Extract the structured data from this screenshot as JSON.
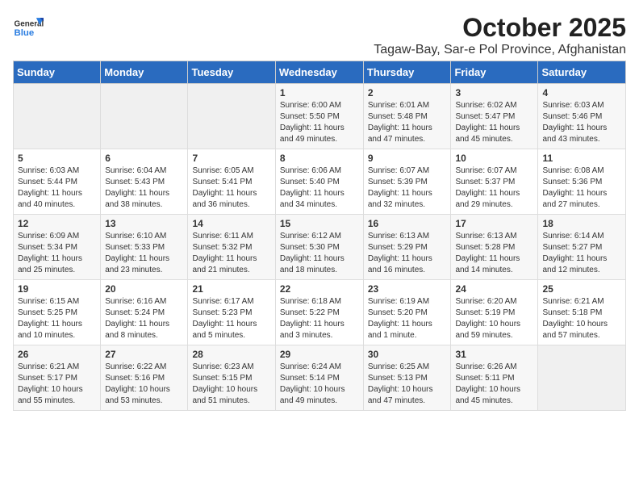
{
  "header": {
    "logo_general": "General",
    "logo_blue": "Blue",
    "title": "October 2025",
    "subtitle": "Tagaw-Bay, Sar-e Pol Province, Afghanistan"
  },
  "calendar": {
    "days_of_week": [
      "Sunday",
      "Monday",
      "Tuesday",
      "Wednesday",
      "Thursday",
      "Friday",
      "Saturday"
    ],
    "weeks": [
      [
        {
          "num": "",
          "info": ""
        },
        {
          "num": "",
          "info": ""
        },
        {
          "num": "",
          "info": ""
        },
        {
          "num": "1",
          "info": "Sunrise: 6:00 AM\nSunset: 5:50 PM\nDaylight: 11 hours and 49 minutes."
        },
        {
          "num": "2",
          "info": "Sunrise: 6:01 AM\nSunset: 5:48 PM\nDaylight: 11 hours and 47 minutes."
        },
        {
          "num": "3",
          "info": "Sunrise: 6:02 AM\nSunset: 5:47 PM\nDaylight: 11 hours and 45 minutes."
        },
        {
          "num": "4",
          "info": "Sunrise: 6:03 AM\nSunset: 5:46 PM\nDaylight: 11 hours and 43 minutes."
        }
      ],
      [
        {
          "num": "5",
          "info": "Sunrise: 6:03 AM\nSunset: 5:44 PM\nDaylight: 11 hours and 40 minutes."
        },
        {
          "num": "6",
          "info": "Sunrise: 6:04 AM\nSunset: 5:43 PM\nDaylight: 11 hours and 38 minutes."
        },
        {
          "num": "7",
          "info": "Sunrise: 6:05 AM\nSunset: 5:41 PM\nDaylight: 11 hours and 36 minutes."
        },
        {
          "num": "8",
          "info": "Sunrise: 6:06 AM\nSunset: 5:40 PM\nDaylight: 11 hours and 34 minutes."
        },
        {
          "num": "9",
          "info": "Sunrise: 6:07 AM\nSunset: 5:39 PM\nDaylight: 11 hours and 32 minutes."
        },
        {
          "num": "10",
          "info": "Sunrise: 6:07 AM\nSunset: 5:37 PM\nDaylight: 11 hours and 29 minutes."
        },
        {
          "num": "11",
          "info": "Sunrise: 6:08 AM\nSunset: 5:36 PM\nDaylight: 11 hours and 27 minutes."
        }
      ],
      [
        {
          "num": "12",
          "info": "Sunrise: 6:09 AM\nSunset: 5:34 PM\nDaylight: 11 hours and 25 minutes."
        },
        {
          "num": "13",
          "info": "Sunrise: 6:10 AM\nSunset: 5:33 PM\nDaylight: 11 hours and 23 minutes."
        },
        {
          "num": "14",
          "info": "Sunrise: 6:11 AM\nSunset: 5:32 PM\nDaylight: 11 hours and 21 minutes."
        },
        {
          "num": "15",
          "info": "Sunrise: 6:12 AM\nSunset: 5:30 PM\nDaylight: 11 hours and 18 minutes."
        },
        {
          "num": "16",
          "info": "Sunrise: 6:13 AM\nSunset: 5:29 PM\nDaylight: 11 hours and 16 minutes."
        },
        {
          "num": "17",
          "info": "Sunrise: 6:13 AM\nSunset: 5:28 PM\nDaylight: 11 hours and 14 minutes."
        },
        {
          "num": "18",
          "info": "Sunrise: 6:14 AM\nSunset: 5:27 PM\nDaylight: 11 hours and 12 minutes."
        }
      ],
      [
        {
          "num": "19",
          "info": "Sunrise: 6:15 AM\nSunset: 5:25 PM\nDaylight: 11 hours and 10 minutes."
        },
        {
          "num": "20",
          "info": "Sunrise: 6:16 AM\nSunset: 5:24 PM\nDaylight: 11 hours and 8 minutes."
        },
        {
          "num": "21",
          "info": "Sunrise: 6:17 AM\nSunset: 5:23 PM\nDaylight: 11 hours and 5 minutes."
        },
        {
          "num": "22",
          "info": "Sunrise: 6:18 AM\nSunset: 5:22 PM\nDaylight: 11 hours and 3 minutes."
        },
        {
          "num": "23",
          "info": "Sunrise: 6:19 AM\nSunset: 5:20 PM\nDaylight: 11 hours and 1 minute."
        },
        {
          "num": "24",
          "info": "Sunrise: 6:20 AM\nSunset: 5:19 PM\nDaylight: 10 hours and 59 minutes."
        },
        {
          "num": "25",
          "info": "Sunrise: 6:21 AM\nSunset: 5:18 PM\nDaylight: 10 hours and 57 minutes."
        }
      ],
      [
        {
          "num": "26",
          "info": "Sunrise: 6:21 AM\nSunset: 5:17 PM\nDaylight: 10 hours and 55 minutes."
        },
        {
          "num": "27",
          "info": "Sunrise: 6:22 AM\nSunset: 5:16 PM\nDaylight: 10 hours and 53 minutes."
        },
        {
          "num": "28",
          "info": "Sunrise: 6:23 AM\nSunset: 5:15 PM\nDaylight: 10 hours and 51 minutes."
        },
        {
          "num": "29",
          "info": "Sunrise: 6:24 AM\nSunset: 5:14 PM\nDaylight: 10 hours and 49 minutes."
        },
        {
          "num": "30",
          "info": "Sunrise: 6:25 AM\nSunset: 5:13 PM\nDaylight: 10 hours and 47 minutes."
        },
        {
          "num": "31",
          "info": "Sunrise: 6:26 AM\nSunset: 5:11 PM\nDaylight: 10 hours and 45 minutes."
        },
        {
          "num": "",
          "info": ""
        }
      ]
    ]
  }
}
